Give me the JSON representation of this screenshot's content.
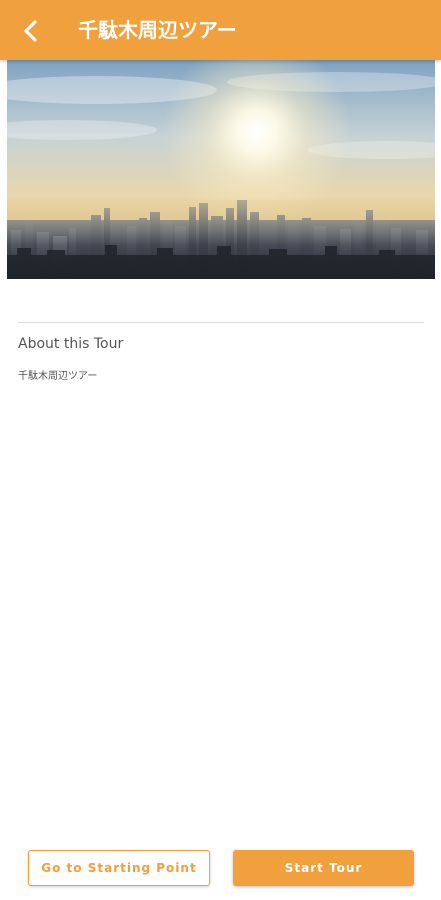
{
  "header": {
    "title": "千駄木周辺ツアー",
    "back_icon": "chevron-left-icon",
    "background_color": "#F0A03C",
    "text_color": "#FFFFFF"
  },
  "hero": {
    "subject": "city skyline at sunrise with sun in hazy sky"
  },
  "about": {
    "heading": "About this Tour",
    "body": "千駄木周辺ツアー"
  },
  "actions": {
    "go_to_start_label": "Go to Starting Point",
    "start_tour_label": "Start Tour"
  },
  "colors": {
    "accent": "#F0A03C",
    "text_muted": "#555555",
    "divider": "#DCDCDC"
  }
}
